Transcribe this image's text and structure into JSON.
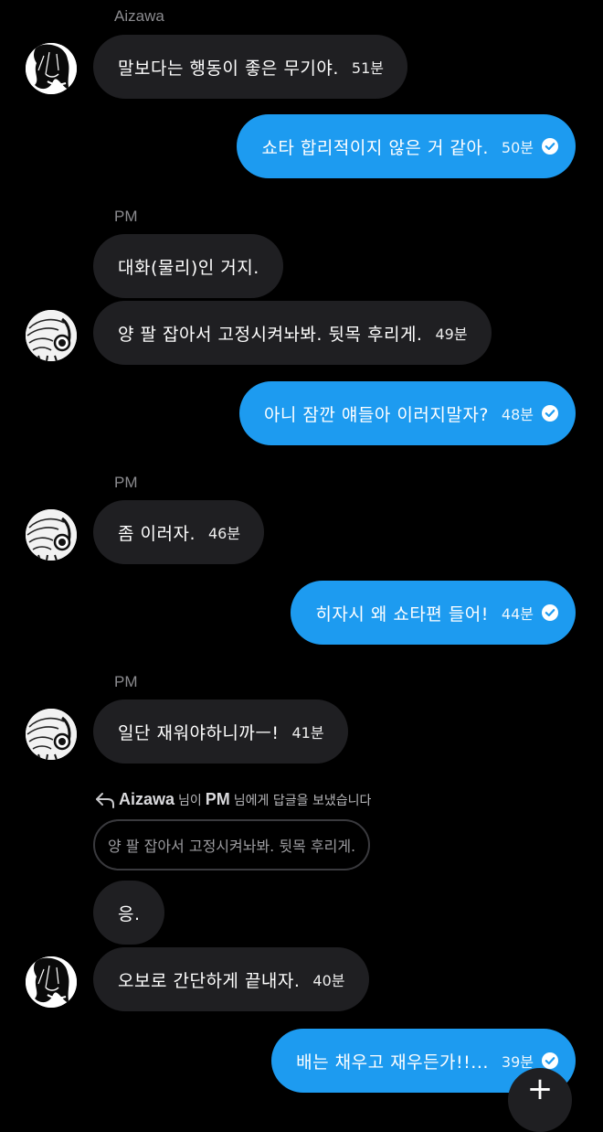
{
  "senders": {
    "aizawa": "Aizawa",
    "pm": "PM"
  },
  "messages": [
    {
      "text": "말보다는 행동이 좋은 무기야.",
      "time": "51분"
    },
    {
      "text": "쇼타 합리적이지 않은 거 같아.",
      "time": "50분"
    },
    {
      "text": "대화(물리)인 거지.",
      "time": ""
    },
    {
      "text": "양 팔 잡아서 고정시켜놔봐. 뒷목 후리게.",
      "time": "49분"
    },
    {
      "text": "아니 잠깐 얘들아 이러지말자?",
      "time": "48분"
    },
    {
      "text": "좀 이러자.",
      "time": "46분"
    },
    {
      "text": "히자시 왜 쇼타편 들어!",
      "time": "44분"
    },
    {
      "text": "일단 재워야하니까ㅡ!",
      "time": "41분"
    },
    {
      "text": "응.",
      "time": ""
    },
    {
      "text": "오보로 간단하게 끝내자.",
      "time": "40분"
    },
    {
      "text": "배는 채우고 재우든가!!...",
      "time": "39분"
    }
  ],
  "reply": {
    "from": "Aizawa",
    "mid": "님이",
    "to": "PM",
    "suffix": "님에게 답글을 보냈습니다",
    "quote": "양 팔 잡아서 고정시켜놔봐. 뒷목 후리게."
  },
  "icons": {
    "reply": "reply-arrow-icon",
    "read": "check-circle-icon",
    "fab": "plus-icon"
  },
  "colors": {
    "background": "#000000",
    "incoming_bubble": "#1f1f22",
    "outgoing_bubble": "#1d9bf0",
    "sender_name": "#8b8b8f"
  }
}
